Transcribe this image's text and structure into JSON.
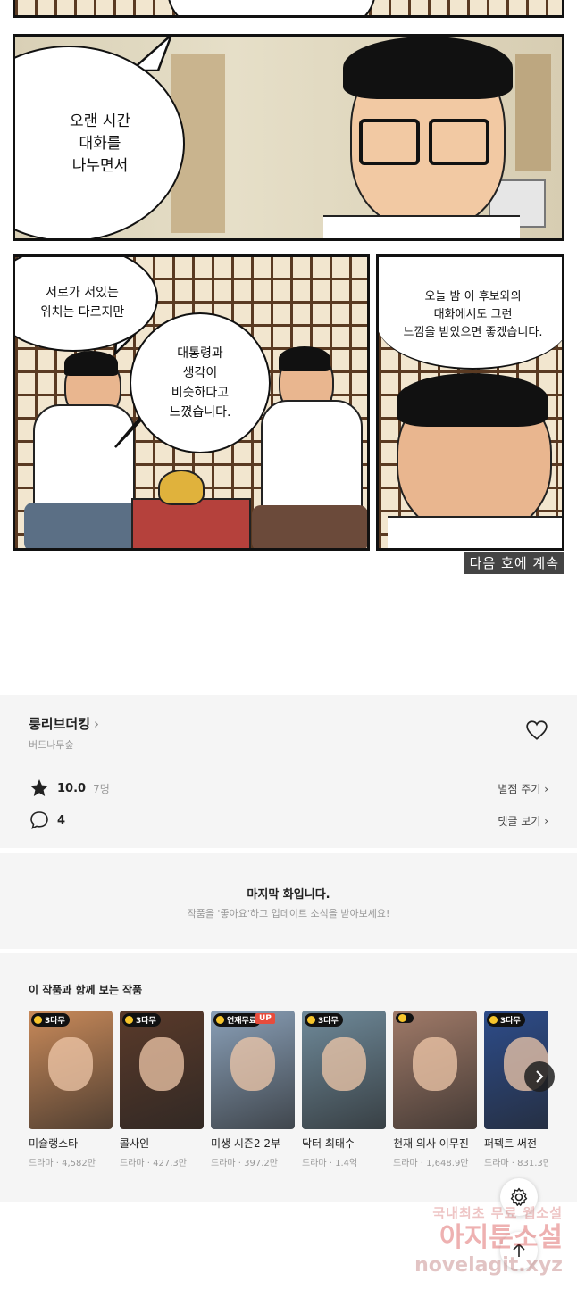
{
  "comic": {
    "panel2": {
      "bubble": "오랜 시간\n대화를\n나누면서"
    },
    "panel3": {
      "bubble_left": "서로가 서있는\n위치는 다르지만",
      "bubble_center": "대통령과\n생각이\n비슷하다고\n느꼈습니다."
    },
    "panel4": {
      "bubble": "오늘 밤 이 후보와의\n대화에서도 그런\n느낌을 받았으면 좋겠습니다."
    },
    "continue_tag": "다음 호에 계속"
  },
  "series": {
    "title": "룽리브더킹",
    "author": "버드나무숲",
    "rating": "10.0",
    "rating_count": "7명",
    "rate_link": "별점 주기",
    "comment_count": "4",
    "comment_link": "댓글 보기"
  },
  "end_notice": {
    "title": "마지막 화입니다.",
    "subtitle": "작품을 '좋아요'하고 업데이트 소식을 받아보세요!"
  },
  "recommendations": {
    "heading": "이 작품과 함께 보는 작품",
    "items": [
      {
        "title": "미슐랭스타",
        "meta": "드라마 · 4,582만",
        "badge": "3다무",
        "color": "#c98a5a"
      },
      {
        "title": "콜사인",
        "meta": "드라마 · 427.3만",
        "badge": "3다무",
        "color": "#5a3a2a"
      },
      {
        "title": "미생 시즌2 2부",
        "meta": "드라마 · 397.2만",
        "badge": "연재무료",
        "extra_badge": "UP",
        "color": "#8aa0b8"
      },
      {
        "title": "닥터 최태수",
        "meta": "드라마 · 1.4억",
        "badge": "3다무",
        "color": "#6f8a9a"
      },
      {
        "title": "천재 의사 이무진",
        "meta": "드라마 · 1,648.9만",
        "badge": "",
        "color": "#a07a68"
      },
      {
        "title": "퍼펙트 써전",
        "meta": "드라마 · 831.3만",
        "badge": "3다무",
        "color": "#2d4c8a"
      }
    ]
  },
  "watermark": {
    "line1": "국내최초 무료 웹소설",
    "line2": "아지툰소설",
    "line3": "novelagit.xyz"
  },
  "icons": {
    "heart": "heart-icon",
    "star": "star-icon",
    "comment": "comment-bubble-icon",
    "next": "chevron-right-icon",
    "settings": "gear-icon",
    "top": "arrow-up-icon"
  }
}
